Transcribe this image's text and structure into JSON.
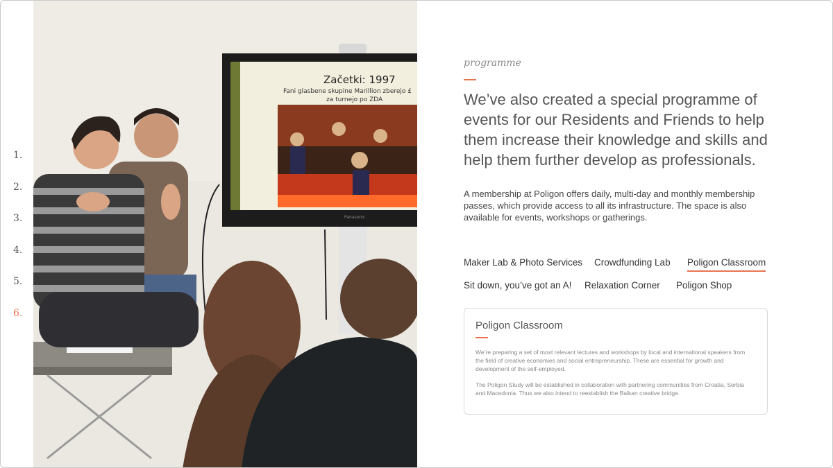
{
  "nav": {
    "items": [
      "1.",
      "2.",
      "3.",
      "4.",
      "5.",
      "6."
    ],
    "active_index": 5
  },
  "photo": {
    "screen_title": "Začetki: 1997",
    "screen_subtitle_1": "Fani glasbene skupine Marillion zberejo £",
    "screen_subtitle_2": "za turnejo po ZDA",
    "tv_brand": "Panasonic"
  },
  "section": {
    "label": "programme",
    "lead": "We’ve also created a special programme of events for our Residents and Friends to help them increase their knowledge and skills and help them further develop as professionals.",
    "body": "A membership at Poligon offers daily, multi-day and monthly membership passes, which provide access to all its infrastructure. The space is also available for events, workshops or gatherings."
  },
  "tabs": [
    {
      "label": "Maker Lab & Photo Services"
    },
    {
      "label": "Crowdfunding Lab"
    },
    {
      "label": "Poligon Classroom"
    },
    {
      "label": "Sit down, you’ve got an A!"
    },
    {
      "label": "Relaxation Corner"
    },
    {
      "label": "Poligon Shop"
    }
  ],
  "active_tab": "Poligon Classroom",
  "card": {
    "title": "Poligon Classroom",
    "p1": "We’re preparing a set of most relevant lectures and workshops by local and international speakers from the field of creative economies and social entrepreneurship. These are essential for growth and development of the self-employed.",
    "p2": "The Poligon Study will be established in collaboration with partnering communities from Croatia, Serbia and Macedonia. Thus we also intend to reestablish the Balkan creative bridge."
  },
  "colors": {
    "accent": "#e8734f",
    "text": "#444444",
    "border": "#d9d9d9"
  }
}
